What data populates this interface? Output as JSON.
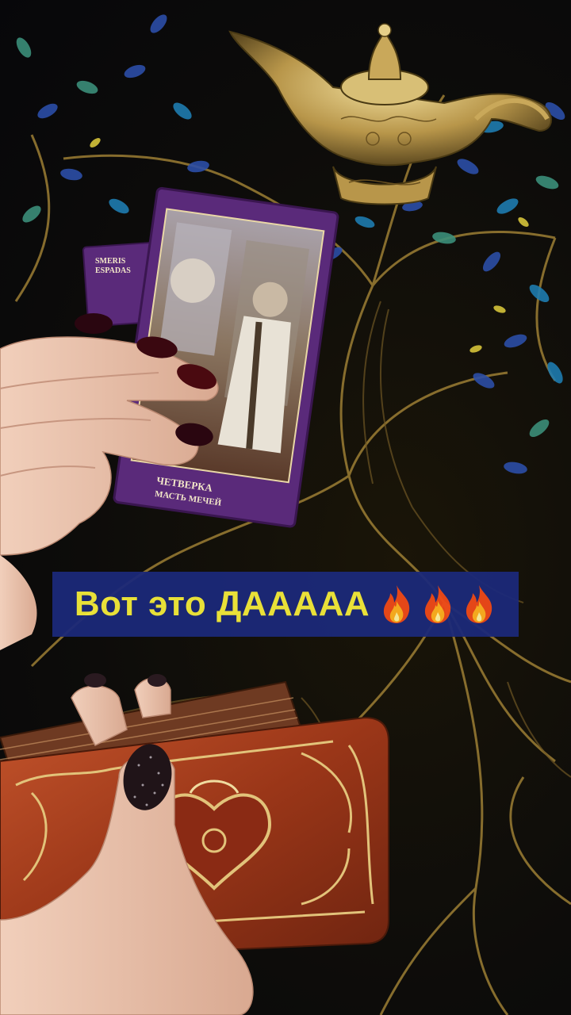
{
  "caption": {
    "text": "Вот это ДААААА",
    "emoji_count": 3,
    "emoji_icon": "fire-icon",
    "text_color": "#f5ec3c",
    "background_color": "#1c2a7a"
  },
  "tarot_card": {
    "bottom_label_line1": "ЧЕТВЕРКА",
    "bottom_label_line2": "МАСТЬ МЕЧЕЙ",
    "side_card_label_line1": "SMERIS",
    "side_card_label_line2": "ESPADAS"
  },
  "colors": {
    "tablecloth": "#0d0c0a",
    "tree_gold": "#a88a3a",
    "leaf_blue": "#2c4fa8",
    "card_purple": "#5a2a7a",
    "deck_red": "#a23a1e",
    "lamp_gold": "#c9a85a",
    "nail_color": "#4a0a10"
  }
}
